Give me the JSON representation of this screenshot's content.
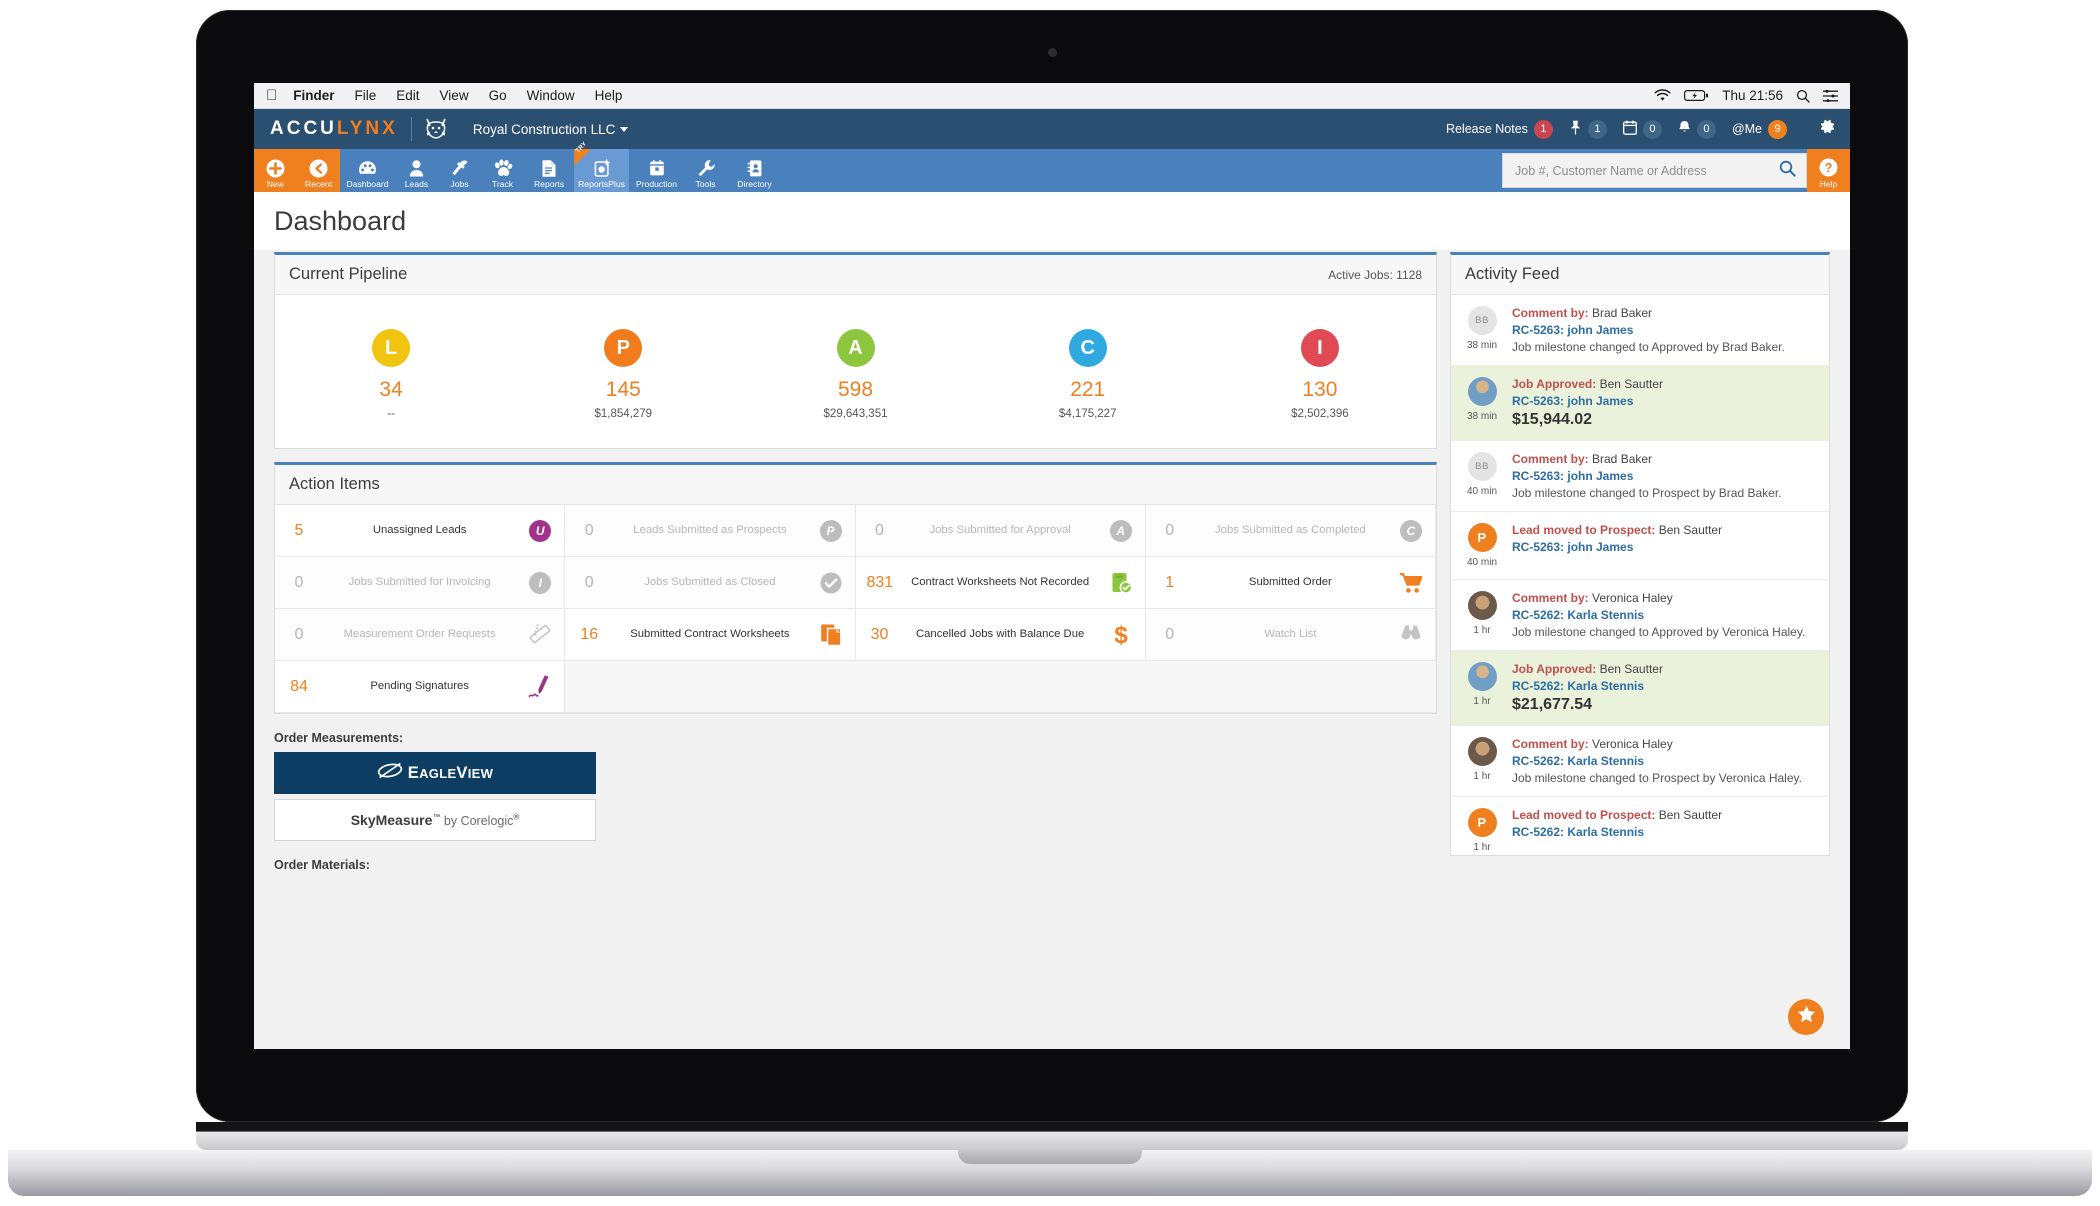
{
  "device": {
    "brand": "MacBook"
  },
  "macbar": {
    "apple_icon": "apple-icon",
    "items": [
      "Finder",
      "File",
      "Edit",
      "View",
      "Go",
      "Window",
      "Help"
    ],
    "clock": "Thu 21:56",
    "icons": [
      "wifi-icon",
      "battery-charging-icon",
      "spotlight-search-icon",
      "control-center-icon"
    ]
  },
  "header": {
    "logo_part1": "ACCU",
    "logo_part2": "LYNX",
    "company": "Royal Construction LLC",
    "release_notes_label": "Release Notes",
    "release_notes_count": "1",
    "pin_count": "1",
    "calendar_count": "0",
    "bell_count": "0",
    "me_label": "@Me",
    "me_count": "9",
    "gear_icon": "gear-icon"
  },
  "nav": {
    "items": [
      {
        "label": "New",
        "icon": "plus-circle-icon",
        "style": "orange"
      },
      {
        "label": "Recent",
        "icon": "back-circle-icon",
        "style": "orange"
      },
      {
        "label": "Dashboard",
        "icon": "dashboard-icon",
        "style": ""
      },
      {
        "label": "Leads",
        "icon": "person-icon",
        "style": ""
      },
      {
        "label": "Jobs",
        "icon": "hammer-icon",
        "style": ""
      },
      {
        "label": "Track",
        "icon": "paw-icon",
        "style": ""
      },
      {
        "label": "Reports",
        "icon": "report-document-icon",
        "style": ""
      },
      {
        "label": "ReportsPlus",
        "icon": "reports-plus-icon",
        "style": "active",
        "badge": "TRY"
      },
      {
        "label": "Production",
        "icon": "calendar-icon",
        "style": ""
      },
      {
        "label": "Tools",
        "icon": "wrench-icon",
        "style": ""
      },
      {
        "label": "Directory",
        "icon": "address-book-icon",
        "style": ""
      }
    ],
    "search_placeholder": "Job #, Customer Name or Address",
    "search_value": "",
    "search_icon": "search-icon",
    "help_label": "Help",
    "help_icon": "question-circle-icon"
  },
  "page": {
    "title": "Dashboard"
  },
  "pipeline": {
    "title": "Current Pipeline",
    "active_jobs_label": "Active Jobs: 1128",
    "stages": [
      {
        "letter": "L",
        "color": "#f1c40f",
        "count": "34",
        "amount": "--"
      },
      {
        "letter": "P",
        "color": "#f07c1e",
        "count": "145",
        "amount": "$1,854,279"
      },
      {
        "letter": "A",
        "color": "#8cc63e",
        "count": "598",
        "amount": "$29,643,351"
      },
      {
        "letter": "C",
        "color": "#2fa9e0",
        "count": "221",
        "amount": "$4,175,227"
      },
      {
        "letter": "I",
        "color": "#e04a52",
        "count": "130",
        "amount": "$2,502,396"
      }
    ]
  },
  "action_items": {
    "title": "Action Items",
    "cells": [
      {
        "count": "5",
        "label": "Unassigned Leads",
        "icon": "badge-u-icon",
        "icon_color": "#a0328c",
        "zero": false
      },
      {
        "count": "0",
        "label": "Leads Submitted as Prospects",
        "icon": "badge-p-icon",
        "icon_color": "#b9b9b9",
        "zero": true
      },
      {
        "count": "0",
        "label": "Jobs Submitted for Approval",
        "icon": "badge-a-icon",
        "icon_color": "#b9b9b9",
        "zero": true
      },
      {
        "count": "0",
        "label": "Jobs Submitted as Completed",
        "icon": "badge-c-icon",
        "icon_color": "#b9b9b9",
        "zero": true
      },
      {
        "count": "0",
        "label": "Jobs Submitted for Invoicing",
        "icon": "badge-i-icon",
        "icon_color": "#b9b9b9",
        "zero": true
      },
      {
        "count": "0",
        "label": "Jobs Submitted as Closed",
        "icon": "check-circle-icon",
        "icon_color": "#b9b9b9",
        "zero": true
      },
      {
        "count": "831",
        "label": "Contract Worksheets Not Recorded",
        "icon": "clipboard-check-icon",
        "icon_color": "#8cc63e",
        "zero": false
      },
      {
        "count": "1",
        "label": "Submitted Order",
        "icon": "shopping-cart-icon",
        "icon_color": "#ef7f1f",
        "zero": false
      },
      {
        "count": "0",
        "label": "Measurement Order Requests",
        "icon": "ruler-icon",
        "icon_color": "#c4c4c4",
        "zero": true
      },
      {
        "count": "16",
        "label": "Submitted Contract Worksheets",
        "icon": "documents-icon",
        "icon_color": "#ef7f1f",
        "zero": false
      },
      {
        "count": "30",
        "label": "Cancelled Jobs with Balance Due",
        "icon": "dollar-sign-icon",
        "icon_color": "#ef7f1f",
        "zero": false
      },
      {
        "count": "0",
        "label": "Watch List",
        "icon": "binoculars-icon",
        "icon_color": "#c4c4c4",
        "zero": true
      },
      {
        "count": "84",
        "label": "Pending Signatures",
        "icon": "signature-pen-icon",
        "icon_color": "#a0328c",
        "zero": false
      }
    ]
  },
  "order_measurements": {
    "label": "Order Measurements:",
    "eagleview": "EAGLEVIEW",
    "eagleview_first": "E",
    "eagleview_rest": "AGLE",
    "eagleview_v": "V",
    "eagleview_tail": "IEW",
    "skymeasure_name": "SkyMeasure",
    "skymeasure_tm": "™",
    "skymeasure_by": " by Corelogic",
    "skymeasure_reg": "®"
  },
  "order_materials": {
    "label": "Order Materials:"
  },
  "activity_feed": {
    "title": "Activity Feed",
    "items": [
      {
        "avatar_type": "initials",
        "avatar_text": "BB",
        "action": "Comment by:",
        "actor": " Brad Baker",
        "job": "RC-5263: john James",
        "detail": "Job milestone changed to Approved by Brad Baker.",
        "amount": "",
        "time": "38 min",
        "highlight": false
      },
      {
        "avatar_type": "photo-m",
        "avatar_text": "",
        "action": "Job Approved:",
        "actor": " Ben Sautter",
        "job": "RC-5263: john James",
        "detail": "",
        "amount": "$15,944.02",
        "time": "38 min",
        "highlight": true
      },
      {
        "avatar_type": "initials",
        "avatar_text": "BB",
        "action": "Comment by:",
        "actor": " Brad Baker",
        "job": "RC-5263: john James",
        "detail": "Job milestone changed to Prospect by Brad Baker.",
        "amount": "",
        "time": "40 min",
        "highlight": false
      },
      {
        "avatar_type": "p",
        "avatar_text": "P",
        "action": "Lead moved to Prospect:",
        "actor": " Ben Sautter",
        "job": "RC-5263: john James",
        "detail": "",
        "amount": "",
        "time": "40 min",
        "highlight": false
      },
      {
        "avatar_type": "photo-f",
        "avatar_text": "",
        "action": "Comment by:",
        "actor": " Veronica Haley",
        "job": "RC-5262: Karla Stennis",
        "detail": "Job milestone changed to Approved by Veronica Haley.",
        "amount": "",
        "time": "1 hr",
        "highlight": false
      },
      {
        "avatar_type": "photo-m",
        "avatar_text": "",
        "action": "Job Approved:",
        "actor": " Ben Sautter",
        "job": "RC-5262: Karla Stennis",
        "detail": "",
        "amount": "$21,677.54",
        "time": "1 hr",
        "highlight": true
      },
      {
        "avatar_type": "photo-f",
        "avatar_text": "",
        "action": "Comment by:",
        "actor": " Veronica Haley",
        "job": "RC-5262: Karla Stennis",
        "detail": "Job milestone changed to Prospect by Veronica Haley.",
        "amount": "",
        "time": "1 hr",
        "highlight": false
      },
      {
        "avatar_type": "p",
        "avatar_text": "P",
        "action": "Lead moved to Prospect:",
        "actor": " Ben Sautter",
        "job": "RC-5262: Karla Stennis",
        "detail": "",
        "amount": "",
        "time": "1 hr",
        "highlight": false
      }
    ],
    "fab_icon": "star-feedback-icon"
  },
  "colors": {
    "brand_orange": "#ef7f1f",
    "header_blue": "#2b4f70",
    "nav_blue": "#4a81bd",
    "highlight_green": "#eaf2dc"
  }
}
